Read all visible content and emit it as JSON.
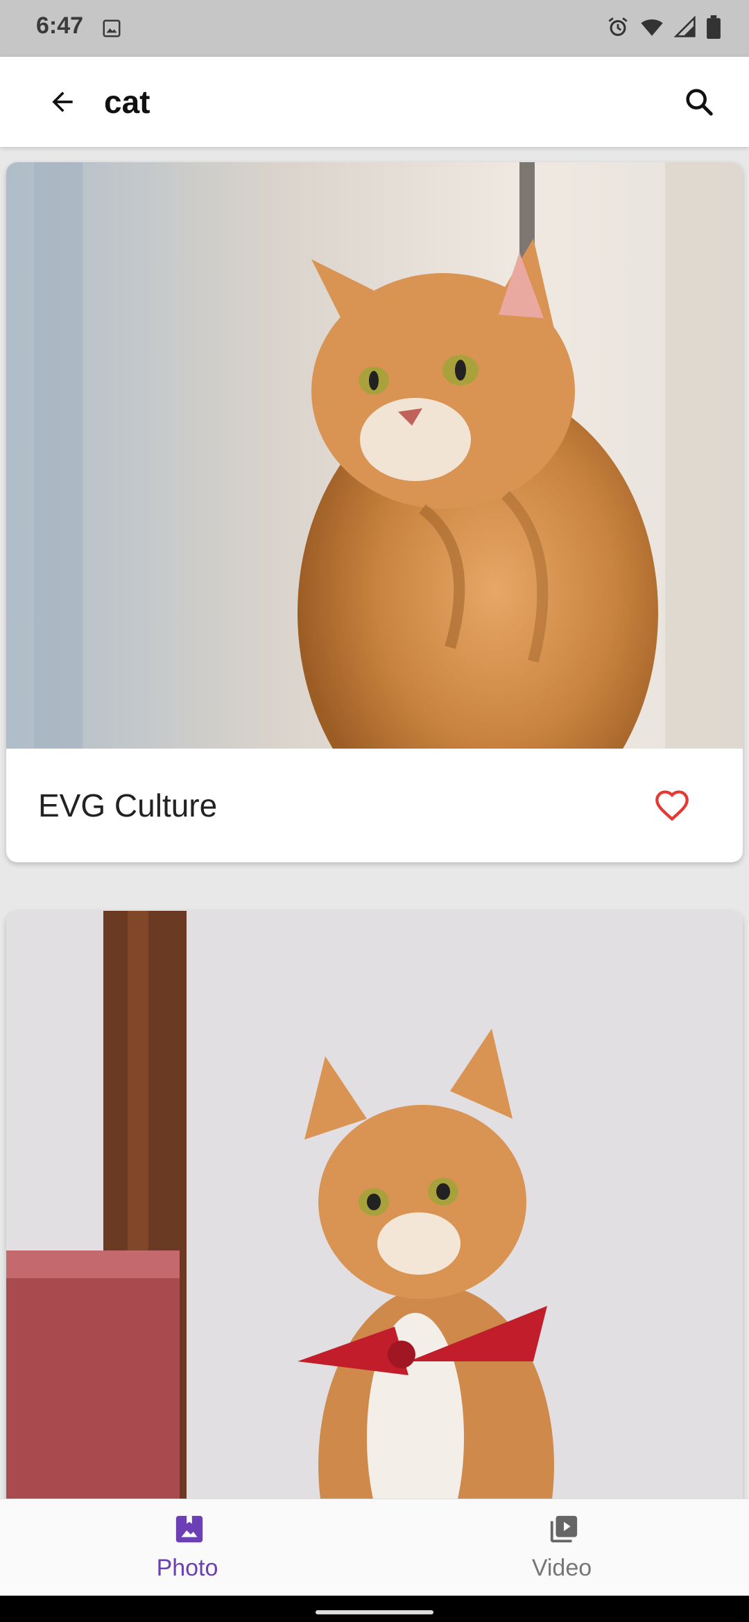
{
  "status_bar": {
    "time": "6:47",
    "icons": [
      "image-icon",
      "alarm-icon",
      "wifi-icon",
      "signal-icon",
      "battery-icon"
    ]
  },
  "app_bar": {
    "title": "cat",
    "back_icon": "arrow-back-icon",
    "search_icon": "search-icon"
  },
  "cards": [
    {
      "photographer": "EVG Culture",
      "favorite_icon": "heart-outline-icon"
    },
    {
      "photographer": ""
    }
  ],
  "bottom_nav": {
    "items": [
      {
        "label": "Photo",
        "icon": "photo-icon",
        "active": true
      },
      {
        "label": "Video",
        "icon": "video-library-icon",
        "active": false
      }
    ]
  },
  "colors": {
    "accent": "#6c3fb5",
    "favorite": "#e53935",
    "status_bar": "#c6c6c6"
  }
}
